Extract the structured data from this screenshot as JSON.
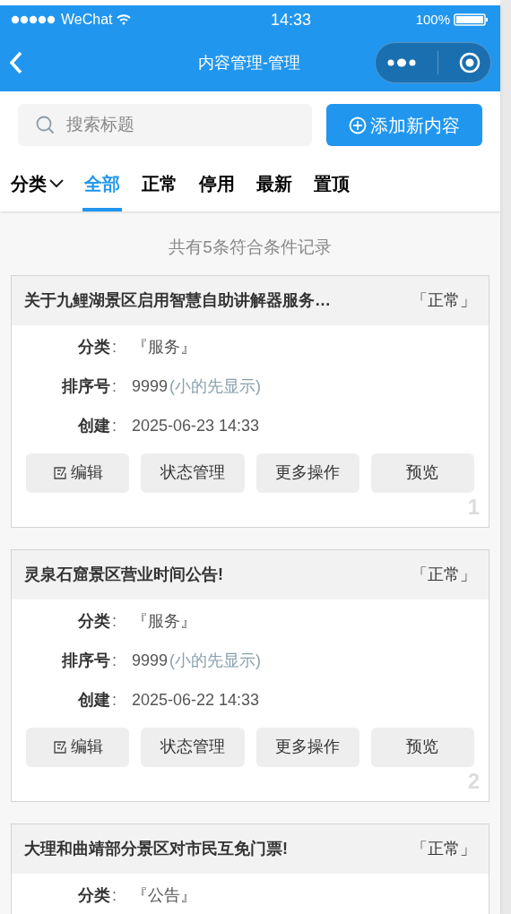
{
  "status_bar": {
    "carrier": "WeChat",
    "time": "14:33",
    "battery": "100%"
  },
  "header": {
    "title": "内容管理-管理"
  },
  "search": {
    "placeholder": "搜索标题"
  },
  "add_button": {
    "label": "添加新内容"
  },
  "filter": {
    "dropdown": "分类",
    "tabs": [
      {
        "label": "全部",
        "selected": true
      },
      {
        "label": "正常",
        "selected": false
      },
      {
        "label": "停用",
        "selected": false
      },
      {
        "label": "最新",
        "selected": false
      },
      {
        "label": "置顶",
        "selected": false
      }
    ]
  },
  "summary": "共有5条符合条件记录",
  "cards": [
    {
      "title": "关于九鲤湖景区启用智慧自助讲解器服务…",
      "status": "「正常」",
      "fields": [
        {
          "label": "分类",
          "colon": ":",
          "value": "『服务』"
        },
        {
          "label": "排序号",
          "colon": ":",
          "value": "9999",
          "note": "(小的先显示)"
        },
        {
          "label": "创建",
          "colon": ":",
          "value": "2025-06-23 14:33"
        }
      ],
      "buttons": [
        {
          "kind": "edit",
          "label": "编辑"
        },
        {
          "kind": "plain",
          "label": "状态管理"
        },
        {
          "kind": "plain",
          "label": "更多操作"
        },
        {
          "kind": "plain",
          "label": "预览"
        }
      ],
      "index": "1"
    },
    {
      "title": "灵泉石窟景区营业时间公告!",
      "status": "「正常」",
      "fields": [
        {
          "label": "分类",
          "colon": ":",
          "value": "『服务』"
        },
        {
          "label": "排序号",
          "colon": ":",
          "value": "9999",
          "note": "(小的先显示)"
        },
        {
          "label": "创建",
          "colon": ":",
          "value": "2025-06-22 14:33"
        }
      ],
      "buttons": [
        {
          "kind": "edit",
          "label": "编辑"
        },
        {
          "kind": "plain",
          "label": "状态管理"
        },
        {
          "kind": "plain",
          "label": "更多操作"
        },
        {
          "kind": "plain",
          "label": "预览"
        }
      ],
      "index": "2"
    },
    {
      "title": "大理和曲靖部分景区对市民互免门票!",
      "status": "「正常」",
      "fields": [
        {
          "label": "分类",
          "colon": ":",
          "value": "『公告』"
        }
      ]
    }
  ]
}
